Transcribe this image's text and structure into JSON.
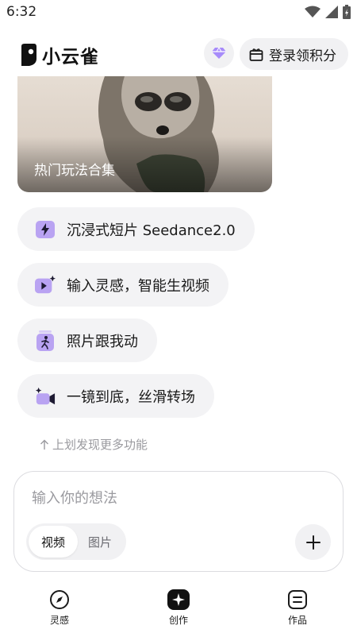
{
  "status_bar": {
    "time": "6:32"
  },
  "header": {
    "app_name": "小云雀",
    "vip_icon": "diamond-icon",
    "login_label": "登录领积分"
  },
  "banner": {
    "title": "热门玩法合集"
  },
  "features": [
    {
      "label": "沉浸式短片 Seedance2.0",
      "icon": "bolt-icon"
    },
    {
      "label": "输入灵感，智能生视频",
      "icon": "play-sparkle-icon"
    },
    {
      "label": "照片跟我动",
      "icon": "dance-photo-icon"
    },
    {
      "label": "一镜到底，丝滑转场",
      "icon": "camera-sparkle-icon"
    }
  ],
  "hint": {
    "text": "上划发现更多功能"
  },
  "composer": {
    "placeholder": "输入你的想法",
    "modes": [
      "视频",
      "图片"
    ],
    "selected_mode": "视频"
  },
  "tabs": [
    {
      "label": "灵感",
      "icon": "compass-icon"
    },
    {
      "label": "创作",
      "icon": "create-icon"
    },
    {
      "label": "作品",
      "icon": "works-icon"
    }
  ],
  "colors": {
    "accent": "#a78bfa",
    "chip_bg": "#f3f3f5",
    "icon_purple": "#b9a3f2"
  }
}
